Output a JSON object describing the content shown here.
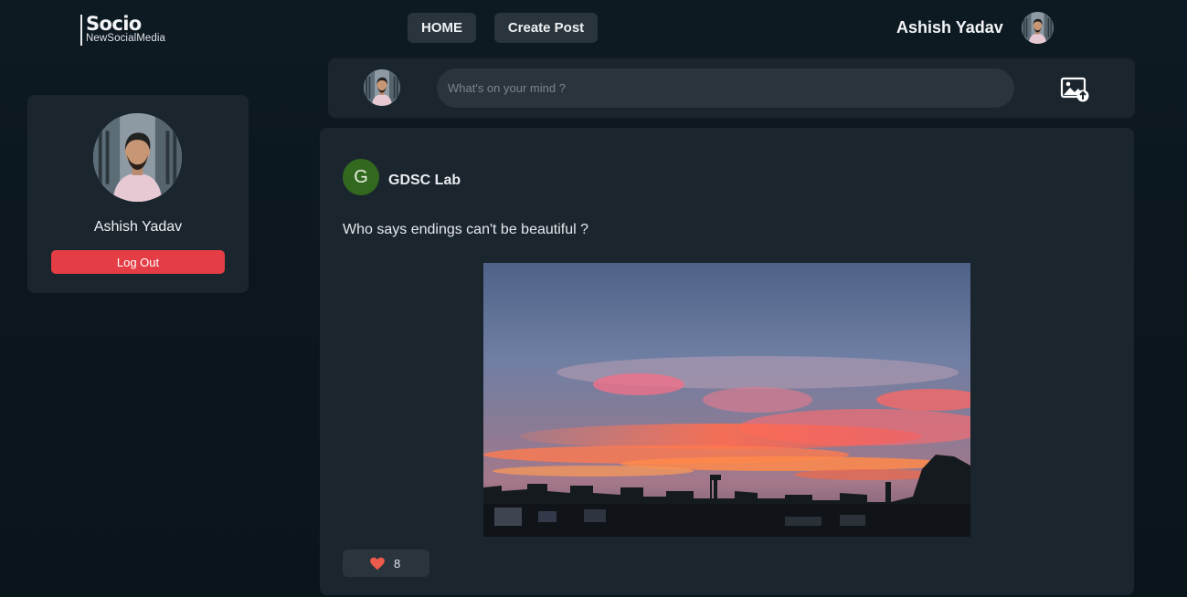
{
  "brand": {
    "name": "Socio",
    "tagline": "NewSocialMedia"
  },
  "nav": {
    "home_label": "HOME",
    "create_post_label": "Create Post"
  },
  "user": {
    "name": "Ashish Yadav",
    "avatar": "user-photo"
  },
  "profile_card": {
    "name": "Ashish Yadav",
    "logout_label": "Log Out"
  },
  "composer": {
    "placeholder": "What's on your mind ?",
    "upload_icon": "image-upload-icon"
  },
  "post": {
    "author_initial": "G",
    "author_name": "GDSC Lab",
    "text": "Who says endings can't be beautiful ?",
    "image": "sunset-photo",
    "likes": "8",
    "like_icon": "heart-icon"
  },
  "colors": {
    "background": "#0e1a22",
    "card": "#1b252e",
    "button": "#2a343d",
    "logout": "#e43d45",
    "author_avatar": "#33691e",
    "heart": "#ec5b4b"
  }
}
